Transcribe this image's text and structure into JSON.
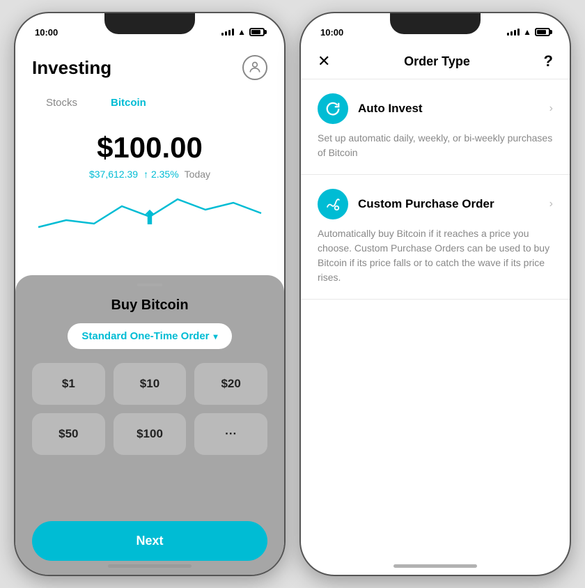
{
  "left_phone": {
    "status_time": "10:00",
    "header": {
      "title": "Investing",
      "avatar_icon": "👤"
    },
    "tabs": [
      {
        "label": "Stocks",
        "active": false
      },
      {
        "label": "Bitcoin",
        "active": true
      }
    ],
    "price": "$100.00",
    "btc_price": "$37,612.39",
    "price_change": "↑ 2.35%",
    "price_today": "Today",
    "modal": {
      "title": "Buy Bitcoin",
      "order_type": "Standard One-Time Order",
      "amounts": [
        "$1",
        "$10",
        "$20",
        "$50",
        "$100",
        "···"
      ],
      "next_label": "Next"
    }
  },
  "right_phone": {
    "status_time": "10:00",
    "header": {
      "title": "Order Type",
      "close_label": "✕",
      "help_label": "?"
    },
    "options": [
      {
        "name": "Auto Invest",
        "icon": "↺",
        "description": "Set up automatic daily, weekly, or bi-weekly purchases of Bitcoin"
      },
      {
        "name": "Custom Purchase Order",
        "icon": "∿",
        "description": "Automatically buy Bitcoin if it reaches a price you choose. Custom Purchase Orders can be used to buy Bitcoin if its price falls or to catch the wave if its price rises."
      }
    ]
  }
}
